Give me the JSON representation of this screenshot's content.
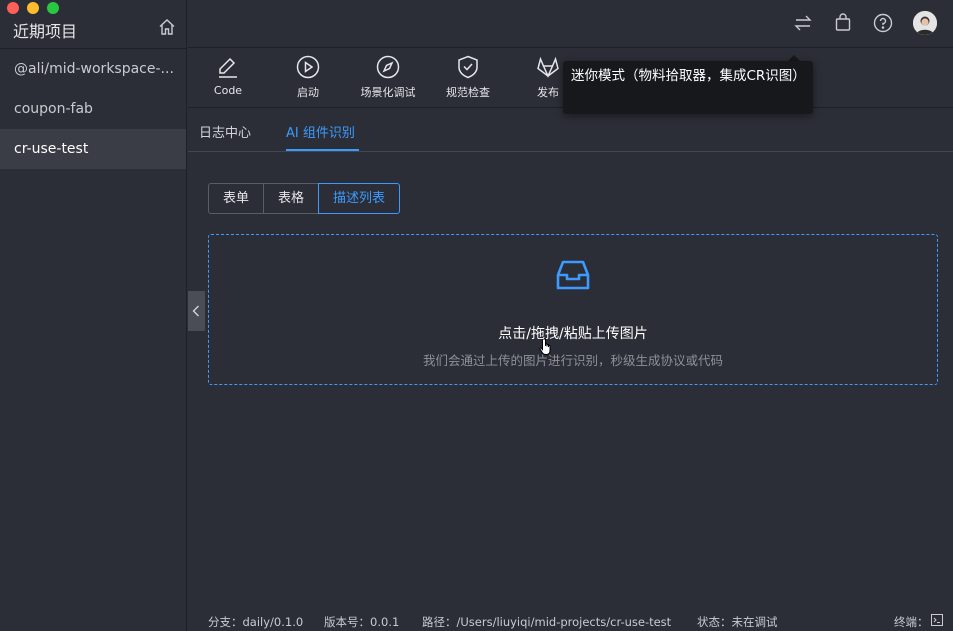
{
  "sidebar": {
    "title": "近期项目",
    "items": [
      {
        "label": "@ali/mid-workspace-..."
      },
      {
        "label": "coupon-fab"
      },
      {
        "label": "cr-use-test"
      }
    ]
  },
  "toolbar": {
    "tools": [
      {
        "label": "Code"
      },
      {
        "label": "启动"
      },
      {
        "label": "场景化调试"
      },
      {
        "label": "规范检查"
      },
      {
        "label": "发布"
      }
    ],
    "tooltip": "迷你模式（物料拾取器，集成CR识图）"
  },
  "tabs": [
    {
      "label": "日志中心"
    },
    {
      "label": "AI 组件识别"
    }
  ],
  "segments": [
    {
      "label": "表单"
    },
    {
      "label": "表格"
    },
    {
      "label": "描述列表"
    }
  ],
  "upload": {
    "title": "点击/拖拽/粘贴上传图片",
    "hint": "我们会通过上传的图片进行识别，秒级生成协议或代码"
  },
  "status": {
    "branch": "分支：daily/0.1.0",
    "version": "版本号：0.0.1",
    "path": "路径：/Users/liuyiqi/mid-projects/cr-use-test",
    "state": "状态：未在调试",
    "terminal": "终端："
  },
  "colors": {
    "accent": "#3d9bff",
    "background": "#2b2d37",
    "tooltip_bg": "#17181c"
  }
}
